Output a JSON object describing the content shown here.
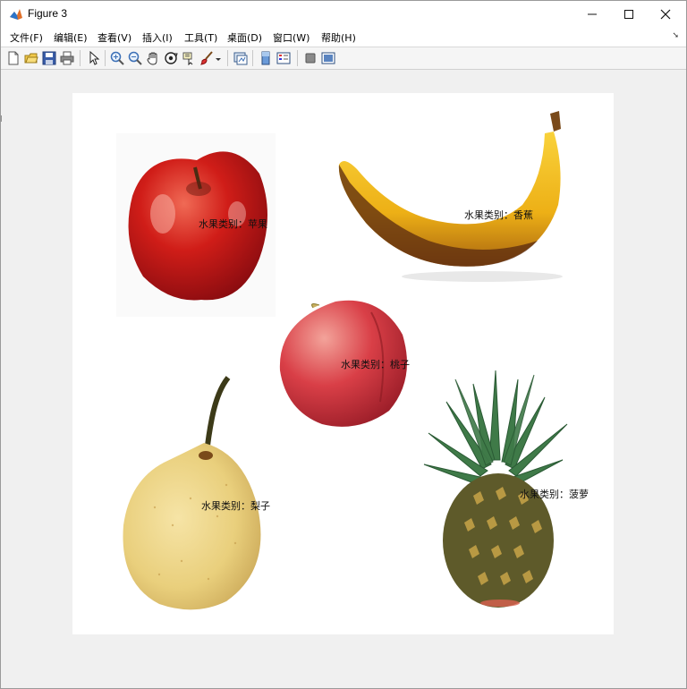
{
  "window": {
    "title": "Figure 3",
    "controls": {
      "minimize": "—",
      "maximize": "☐",
      "close": "✕"
    }
  },
  "menu": {
    "items": [
      "文件(F)",
      "编辑(E)",
      "查看(V)",
      "插入(I)",
      "工具(T)",
      "桌面(D)",
      "窗口(W)",
      "帮助(H)"
    ]
  },
  "toolbar": {
    "icons": [
      "new-figure-icon",
      "open-file-icon",
      "save-icon",
      "print-icon",
      "select-arrow-icon",
      "zoom-in-icon",
      "zoom-out-icon",
      "pan-hand-icon",
      "rotate-3d-icon",
      "data-cursor-icon",
      "brush-icon",
      "brush-dropdown-icon",
      "link-plot-icon",
      "insert-colorbar-icon",
      "insert-legend-icon",
      "hide-plot-tools-icon",
      "show-plot-tools-icon"
    ]
  },
  "figure": {
    "labels": {
      "apple": "水果类别：苹果",
      "banana": "水果类别：香蕉",
      "peach": "水果类别：桃子",
      "pear": "水果类别：梨子",
      "pineapple": "水果类别：菠萝"
    }
  }
}
